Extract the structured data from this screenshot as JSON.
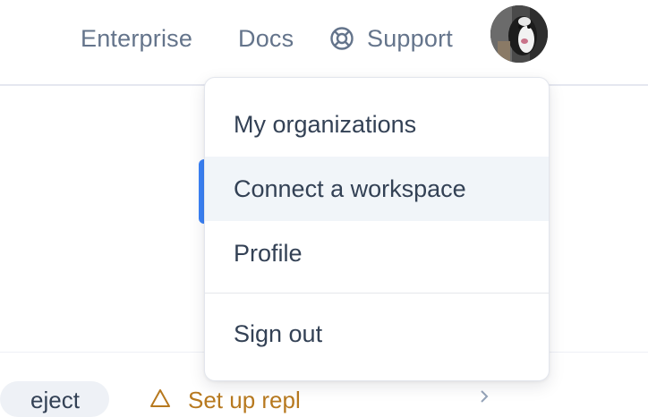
{
  "nav": {
    "enterprise": "Enterprise",
    "docs": "Docs",
    "support": "Support",
    "support_icon": "lifebuoy-icon",
    "avatar_icon": "user-avatar"
  },
  "dropdown": {
    "items": [
      {
        "label": "My organizations"
      },
      {
        "label": "Connect a workspace",
        "highlighted": true
      },
      {
        "label": "Profile"
      },
      {
        "label": "Sign out"
      }
    ]
  },
  "page": {
    "chip_label": "eject",
    "warning_text": "Set up repl",
    "warning_icon": "warning-triangle-icon",
    "chevron_icon": "chevron-right-icon"
  },
  "colors": {
    "accent": "#3b82f6",
    "nav_text": "#64748b",
    "menu_text": "#334155",
    "highlight_bg": "#f1f5f9",
    "warning": "#b7791f"
  }
}
